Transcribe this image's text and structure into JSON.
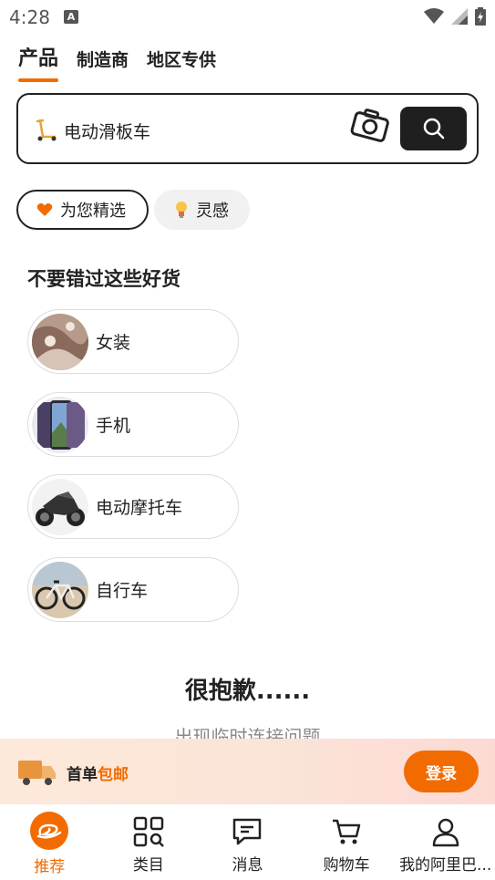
{
  "status_bar": {
    "time": "4:28",
    "a_badge": "A"
  },
  "top_tabs": [
    {
      "label": "产品",
      "active": true
    },
    {
      "label": "制造商",
      "active": false
    },
    {
      "label": "地区专供",
      "active": false
    }
  ],
  "search": {
    "value": "电动滑板车"
  },
  "pills": {
    "selected": "为您精选",
    "inspiration": "灵感"
  },
  "section": {
    "title": "不要错过这些好货"
  },
  "categories": [
    {
      "label": "女装"
    },
    {
      "label": "手机"
    },
    {
      "label": "电动摩托车"
    },
    {
      "label": "自行车"
    }
  ],
  "error": {
    "title": "很抱歉......",
    "subtitle": "出现临时连接问题"
  },
  "promo": {
    "text_prefix": "首单",
    "text_accent": "包邮",
    "login": "登录"
  },
  "bottom_nav": [
    {
      "label": "推荐",
      "icon": "home-logo-icon",
      "active": true
    },
    {
      "label": "类目",
      "icon": "category-search-icon",
      "active": false
    },
    {
      "label": "消息",
      "icon": "message-icon",
      "active": false
    },
    {
      "label": "购物车",
      "icon": "cart-icon",
      "active": false
    },
    {
      "label": "我的阿里巴...",
      "icon": "profile-icon",
      "active": false
    }
  ],
  "colors": {
    "accent": "#f26b00",
    "dark": "#1f1f1f"
  }
}
